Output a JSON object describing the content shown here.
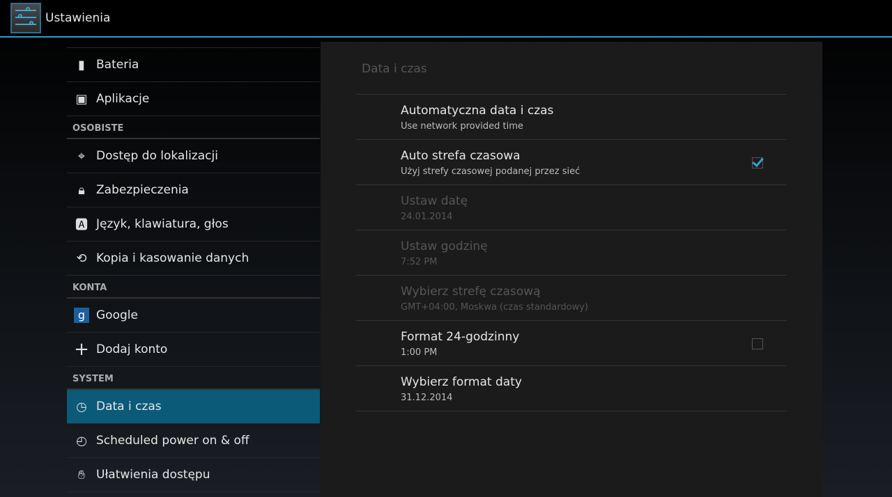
{
  "header": {
    "title": "Ustawienia",
    "icon": "settings-sliders-icon"
  },
  "sidebar": {
    "items_top": [
      {
        "label": "Bateria",
        "icon": "battery-icon"
      },
      {
        "label": "Aplikacje",
        "icon": "apps-icon"
      }
    ],
    "sections": [
      {
        "title": "OSOBISTE",
        "items": [
          {
            "label": "Dostęp do lokalizacji",
            "icon": "location-icon"
          },
          {
            "label": "Zabezpieczenia",
            "icon": "lock-icon"
          },
          {
            "label": "Język, klawiatura, głos",
            "icon": "language-icon"
          },
          {
            "label": "Kopia i kasowanie danych",
            "icon": "backup-icon"
          }
        ]
      },
      {
        "title": "KONTA",
        "items": [
          {
            "label": "Google",
            "icon": "google-icon"
          },
          {
            "label": "Dodaj konto",
            "icon": "plus-icon"
          }
        ]
      },
      {
        "title": "SYSTEM",
        "items": [
          {
            "label": "Data i czas",
            "icon": "clock-icon",
            "selected": true
          },
          {
            "label": "Scheduled power on & off",
            "icon": "power-schedule-icon"
          },
          {
            "label": "Ułatwienia dostępu",
            "icon": "hand-icon"
          }
        ]
      }
    ]
  },
  "panel": {
    "title": "Data i czas",
    "items": [
      {
        "title": "Automatyczna data i czas",
        "subtitle": "Use network provided time",
        "enabled": true
      },
      {
        "title": "Auto strefa czasowa",
        "subtitle": "Użyj strefy czasowej podanej przez sieć",
        "enabled": true,
        "checkbox": true,
        "checked": true
      },
      {
        "title": "Ustaw datę",
        "subtitle": "24.01.2014",
        "enabled": false
      },
      {
        "title": "Ustaw godzinę",
        "subtitle": "7:52 PM",
        "enabled": false
      },
      {
        "title": "Wybierz strefę czasową",
        "subtitle": "GMT+04:00, Moskwa (czas standardowy)",
        "enabled": false
      },
      {
        "title": "Format 24-godzinny",
        "subtitle": "1:00 PM",
        "enabled": true,
        "checkbox": true,
        "checked": false
      },
      {
        "title": "Wybierz format daty",
        "subtitle": "31.12.2014",
        "enabled": true
      }
    ]
  },
  "colors": {
    "accent": "#2a9fc9",
    "selected": "#0b5a78"
  }
}
